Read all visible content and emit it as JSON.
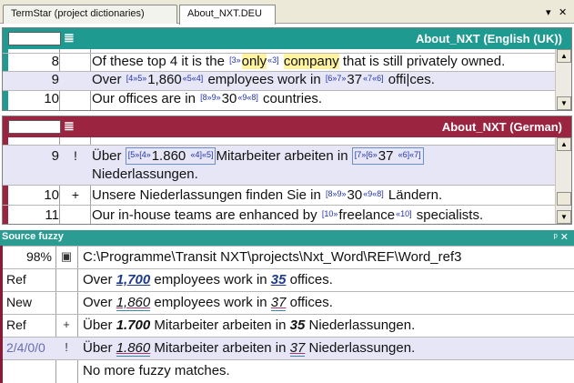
{
  "tabs": [
    {
      "label": "TermStar (project dictionaries)"
    },
    {
      "label": "About_NXT.DEU"
    }
  ],
  "tab_controls": {
    "menu": "▾",
    "close": "✕"
  },
  "english_pane": {
    "title": "About_NXT (English (UK))",
    "color": "#1f9a90",
    "rows": [
      {
        "num": "8",
        "flag": "",
        "text": "Of these top 4 it is the [3»only«3] company that is still privately owned."
      },
      {
        "num": "9",
        "flag": "",
        "text": "Over [4»5»1,860«5«4] employees work in [6»7»37«7«6] offices."
      },
      {
        "num": "10",
        "flag": "",
        "text": "Our offices are in [8»9»30«9«8] countries."
      }
    ]
  },
  "german_pane": {
    "title": "About_NXT (German)",
    "color": "#9b2440",
    "rows": [
      {
        "num": "9",
        "flag": "!",
        "text_line1": "Über [5»[4»1.860 «4]«5]Mitarbeiter arbeiten in [7»[6»37 «6]«7]",
        "text_line2": "Niederlassungen."
      },
      {
        "num": "10",
        "flag": "+",
        "text": "Unsere Niederlassungen finden Sie in [8»9»30«9«8] Ländern."
      },
      {
        "num": "11",
        "flag": "",
        "text": "Our in-house teams are enhanced by [10»freelance«10] specialists."
      }
    ]
  },
  "fuzzy_panel": {
    "title": "Source fuzzy",
    "pin": "ᵖ ✕",
    "rows": [
      {
        "c1": "98%",
        "c2": "",
        "text": "C:\\Programme\\Transit NXT\\projects\\Nxt_Word\\REF\\Word_ref3"
      },
      {
        "c1": "Ref",
        "c2": "",
        "pre": "Over ",
        "num": "1,700",
        "mid": " employees work in ",
        "num2": "35",
        "post": " offices."
      },
      {
        "c1": "New",
        "c2": "",
        "pre": "Over ",
        "num": "1,860",
        "mid": " employees work in ",
        "num2": "37",
        "post": " offices."
      },
      {
        "c1": "Ref",
        "c2": "+",
        "pre": "Über ",
        "num": "1.700",
        "mid": " Mitarbeiter arbeiten in ",
        "num2": "35",
        "post": " Niederlassungen."
      },
      {
        "c1": "2/4/0/0",
        "c2": "!",
        "pre": "Über ",
        "num": "1.860",
        "mid": " Mitarbeiter arbeiten in ",
        "num2": "37",
        "post": " Niederlassungen."
      },
      {
        "c1": "",
        "c2": "",
        "text": "No more fuzzy matches."
      }
    ]
  }
}
